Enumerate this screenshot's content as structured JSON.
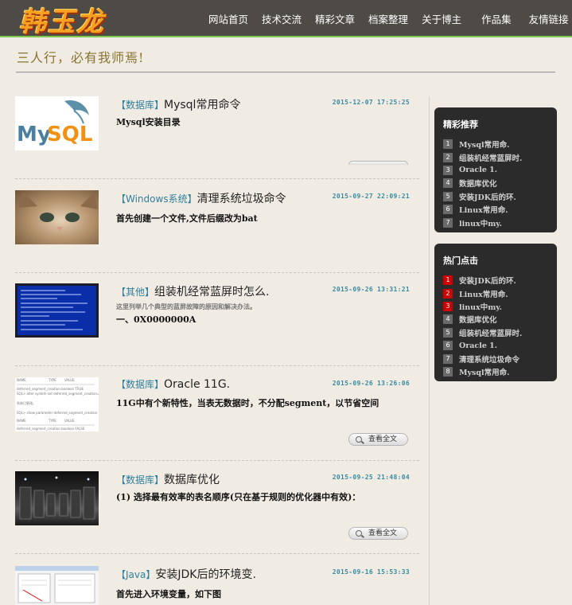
{
  "header": {
    "logo_text": "韩玉龙",
    "nav": [
      "网站首页",
      "技术交流",
      "精彩文章",
      "档案整理",
      "关于博主",
      "作品集",
      "友情链接"
    ]
  },
  "motto": "三人行，必有我师焉!",
  "articles": [
    {
      "category": "【数据库】",
      "title": "Mysql常用命令",
      "date": "2015-12-07 17:25:25",
      "summary": "Mysql安装目录",
      "sub": "",
      "thumb": "mysql-logo"
    },
    {
      "category": "【Windows系统】",
      "title": "清理系统垃圾命令",
      "date": "2015-09-27 22:09:21",
      "summary": "首先创建一个文件,文件后缀改为bat",
      "sub": "",
      "thumb": "kitten-photo"
    },
    {
      "category": "【其他】",
      "title": "组装机经常蓝屏时怎么.",
      "date": "2015-09-26 13:31:21",
      "summary": "一、0X0000000A",
      "sub": "这里列举几个典型的蓝屏故障的原因和解决办法。",
      "thumb": "bluescreen-photo"
    },
    {
      "category": "【数据库】",
      "title": "Oracle 11G.",
      "date": "2015-09-26 13:26:06",
      "summary": "11G中有个新特性，当表无数据时，不分配segment，以节省空间",
      "sub": "",
      "thumb": "oracle-screenshot"
    },
    {
      "category": "【数据库】",
      "title": "数据库优化",
      "date": "2015-09-25 21:48:04",
      "summary": "(1)  选择最有效率的表名顺序(只在基于规则的优化器中有效)：",
      "sub": "",
      "thumb": "server-room-photo"
    },
    {
      "category": "【Java】",
      "title": "安装JDK后的环境变.",
      "date": "2015-09-16 15:53:33",
      "summary": "首先进入环境变量，如下图",
      "sub": "",
      "thumb": "dialog-screenshot"
    }
  ],
  "read_more": "查看全文",
  "sidebar": {
    "recommend": {
      "title": "精彩推荐",
      "items": [
        "Mysql常用命.",
        "组装机经常蓝屏时.",
        "Oracle 1.",
        "数据库优化",
        "安装JDK后的环.",
        "Linux常用命.",
        "linux中my."
      ]
    },
    "hot": {
      "title": "热门点击",
      "items": [
        "安装JDK后的环.",
        "Linux常用命.",
        "linux中my.",
        "数据库优化",
        "组装机经常蓝屏时.",
        "Oracle 1.",
        "清理系统垃圾命令",
        "Mysql常用命."
      ]
    }
  },
  "colors": {
    "header_bg": "#4e4b46",
    "accent_green": "#7ec850",
    "category": "#2f7f9c",
    "hot_rank": "#d00000"
  }
}
